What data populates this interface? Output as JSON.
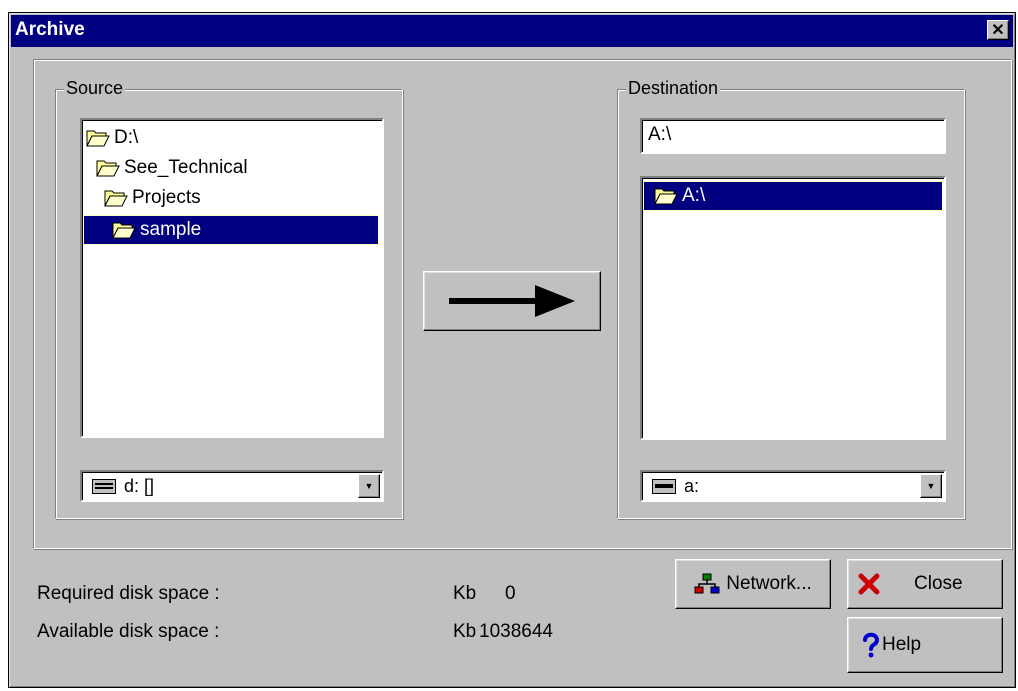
{
  "window": {
    "title": "Archive",
    "close_glyph": "✕"
  },
  "source": {
    "label": "Source",
    "tree": [
      {
        "label": "D:\\",
        "icon": "open-folder-icon"
      },
      {
        "label": "See_Technical",
        "icon": "open-folder-icon"
      },
      {
        "label": "Projects",
        "icon": "open-folder-icon"
      },
      {
        "label": "sample",
        "icon": "open-folder-icon",
        "selected": true
      }
    ],
    "drive": {
      "value": "d: []",
      "icon": "drive-icon"
    }
  },
  "transfer": {
    "icon": "right-arrow-icon"
  },
  "destination": {
    "label": "Destination",
    "path_value": "A:\\",
    "tree": [
      {
        "label": "A:\\",
        "icon": "open-folder-icon",
        "selected": true
      }
    ],
    "drive": {
      "value": "a:",
      "icon": "floppy-drive-icon"
    }
  },
  "disk_space": {
    "required_label": "Required disk space :",
    "required_unit": "Kb",
    "required_value": "0",
    "available_label": "Available disk space :",
    "available_unit": "Kb",
    "available_value": "1038644"
  },
  "buttons": {
    "network": "Network...",
    "close": "Close",
    "help": "Help"
  },
  "colors": {
    "titlebar": "#000080",
    "selection": "#000080",
    "dialog": "#c0c0c0",
    "close_icon": "#cc0000"
  }
}
